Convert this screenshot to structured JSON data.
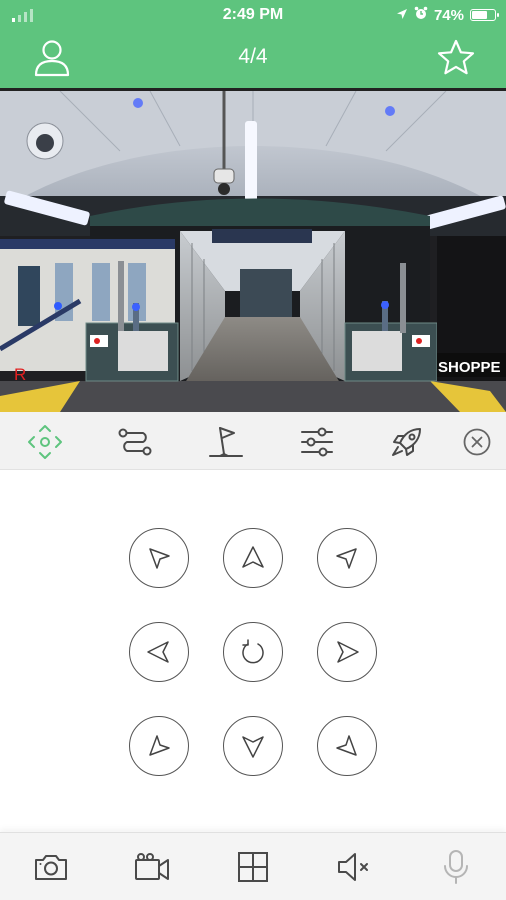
{
  "status_bar": {
    "time": "2:49 PM",
    "battery_text": "74%",
    "battery_level": 0.74,
    "signal_bars_on": 1,
    "icons": [
      "signal-icon",
      "location-arrow-icon",
      "alarm-icon",
      "battery-icon"
    ]
  },
  "header": {
    "title": "4/4",
    "left_icon": "user-icon",
    "right_icon": "star-icon",
    "background": "#5ec47e"
  },
  "camera": {
    "overlay_label": "R",
    "sign_text": "SHOPPE",
    "overlay_color": "#e02020"
  },
  "toolbar": {
    "items": [
      "ptz-control-icon",
      "route-icon",
      "flag-icon",
      "sliders-icon",
      "rocket-icon"
    ],
    "active_item": "ptz-control-icon",
    "close_icon": "close-circle-icon",
    "accent": "#5ec47e"
  },
  "ptz_pad": {
    "buttons": [
      "up-left",
      "up",
      "up-right",
      "left",
      "reset",
      "right",
      "down-left",
      "down",
      "down-right"
    ]
  },
  "bottom_bar": {
    "items": [
      "camera-snapshot-icon",
      "video-record-icon",
      "grid-layout-icon",
      "mute-icon",
      "microphone-icon"
    ],
    "disabled_item": "microphone-icon"
  }
}
